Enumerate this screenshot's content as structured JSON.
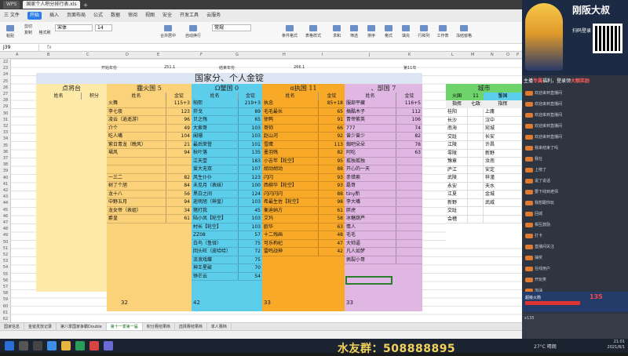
{
  "window": {
    "tabs": [
      "WPS",
      "国家个人积分排行表.xls"
    ],
    "plus": "+"
  },
  "menubar": {
    "items": [
      "三 文件",
      "开始",
      "插入",
      "页面布局",
      "公式",
      "数据",
      "审阅",
      "视图",
      "安全",
      "开发工具",
      "云服务"
    ],
    "active_index": 1
  },
  "ribbon": {
    "font_name": "宋体",
    "font_size": "14",
    "number_format": "常规",
    "buttons": [
      "粘贴",
      "剪切",
      "复制",
      "格式刷",
      "合并居中",
      "自动换行",
      "条件格式",
      "表格样式",
      "求和",
      "筛选",
      "排序",
      "格式",
      "填充",
      "行和列",
      "工作表",
      "冻结窗格"
    ]
  },
  "formula_bar": {
    "name_box": "J39",
    "fx": "fx"
  },
  "columns": [
    "A",
    "B",
    "C",
    "D",
    "E",
    "F",
    "G",
    "H",
    "I",
    "J",
    "K",
    "L",
    "M",
    "N",
    "O",
    "P"
  ],
  "rows": [
    "22",
    "23",
    "24",
    "25",
    "26",
    "27",
    "28",
    "29",
    "30",
    "31",
    "32",
    "33",
    "34",
    "35",
    "36",
    "37",
    "38",
    "39",
    "40",
    "41",
    "42",
    "43",
    "44",
    "45",
    "46",
    "47",
    "48",
    "49",
    "50",
    "51",
    "52",
    "53",
    "54",
    "55",
    "56",
    "57",
    "58",
    "59",
    "60",
    "61",
    "62"
  ],
  "header_row": {
    "start_label": "开始年份",
    "start_value": "251.1",
    "end_label": "结束年份",
    "end_value": "266.1",
    "round": "第11年"
  },
  "title": "国家分、个人金锭",
  "panels": {
    "dianjiangtai": {
      "title": "点将台",
      "col_name": "姓名",
      "col_score": "积分",
      "rows": []
    },
    "huoguo": {
      "title": "霾火国 5",
      "col_name": "姓名",
      "col_score": "金锭",
      "rows": [
        [
          "火舞",
          "115+3"
        ],
        [
          "李七夜",
          "123"
        ],
        [
          "凌云（逍遥游）",
          "96"
        ],
        [
          "介个",
          "49"
        ],
        [
          "吃人嘴",
          "104"
        ],
        [
          "紫日青龙（晚风）",
          "21"
        ],
        [
          "珺风",
          "94"
        ],
        [
          "",
          ""
        ],
        [
          "",
          ""
        ],
        [
          "一三二",
          "82"
        ],
        [
          "树了个旭",
          "84"
        ],
        [
          "龙十八",
          "56"
        ],
        [
          "中野五月",
          "94"
        ],
        [
          "龙女帝（表姐）",
          "34"
        ],
        [
          "爵皇",
          "61"
        ]
      ],
      "total": "32"
    },
    "xieguo": {
      "title": "Ω蟹国 0",
      "col_name": "姓名",
      "col_score": "金锭",
      "rows": [
        [
          "帕熙",
          "219+3"
        ],
        [
          "拌戈",
          "89"
        ],
        [
          "贝之殇",
          "65"
        ],
        [
          "大索哥",
          "103"
        ],
        [
          "阑珊",
          "103"
        ],
        [
          "最后荣誉",
          "101"
        ],
        [
          "秋叶落",
          "135"
        ],
        [
          "江天壹",
          "183"
        ],
        [
          "爱大无双",
          "107"
        ],
        [
          "风生仆仆",
          "123"
        ],
        [
          "未见月（表妹）",
          "100"
        ],
        [
          "黑白之间",
          "124"
        ],
        [
          "逝明旭（神皇）",
          "103"
        ],
        [
          "猪打我",
          "45"
        ],
        [
          "陆小凤【轮空】",
          "103"
        ],
        [
          "村长【轮空】",
          "103"
        ],
        [
          "ZZ08",
          "57"
        ],
        [
          "白鸟（鲁铎）",
          "75"
        ],
        [
          "回头旺（皮哈哈）",
          "72"
        ],
        [
          "流浪戏蝶",
          "75"
        ],
        [
          "神王星破",
          "70"
        ],
        [
          "铮芒云",
          "54"
        ]
      ],
      "total": "42"
    },
    "zhiguo": {
      "title": "α执国 11",
      "col_name": "姓名",
      "col_score": "金锭",
      "rows": [
        [
          "执念",
          "85+18"
        ],
        [
          "毛毛最长",
          "65"
        ],
        [
          "徐鸭",
          "91"
        ],
        [
          "哥帅",
          "66"
        ],
        [
          "赵山河",
          "92"
        ],
        [
          "雪鹰",
          "113"
        ],
        [
          "墨羽殇",
          "82"
        ],
        [
          "小吉年【轮空】",
          "95"
        ],
        [
          "胡动胡动",
          "88"
        ],
        [
          "闪闪",
          "93"
        ],
        [
          "西柳华【轮空】",
          "93"
        ],
        [
          "闪闪闪闪",
          "88"
        ],
        [
          "希最生佐【轮空】",
          "98"
        ],
        [
          "衡迪纳方",
          "61"
        ],
        [
          "艾玛",
          "58"
        ],
        [
          "欧华",
          "63"
        ],
        [
          "十二残画",
          "48"
        ],
        [
          "可乐枸杞",
          "47"
        ],
        [
          "雷鸣战神",
          "42"
        ]
      ],
      "total": "33"
    },
    "buguo": {
      "title": "、部国 7",
      "col_name": "姓名",
      "col_score": "金锭",
      "rows": [
        [
          "服部平藏",
          "116+5"
        ],
        [
          "搞酷木子",
          "112"
        ],
        [
          "青帝紫英",
          "106"
        ],
        [
          "777",
          "74"
        ],
        [
          "曾少曾少",
          "82"
        ],
        [
          "蜘吧朵朵",
          "78"
        ],
        [
          "阿吃",
          "63"
        ],
        [
          "孤独孤独",
          ""
        ],
        [
          "开心的一天",
          ""
        ],
        [
          "赤错索",
          ""
        ],
        [
          "磊哥",
          ""
        ],
        [
          "tiny新",
          ""
        ],
        [
          "李大嘴",
          ""
        ],
        [
          "胖虎",
          ""
        ],
        [
          "冰糖葫芦",
          ""
        ],
        [
          "情人",
          ""
        ],
        [
          "毛毛",
          ""
        ],
        [
          "大帅逼",
          ""
        ],
        [
          "凡人如梦",
          ""
        ],
        [
          "佩裂小哥",
          ""
        ]
      ],
      "total": "33"
    },
    "city": {
      "title": "城市",
      "sub1": "火国",
      "sub1_count": "11",
      "sub2": "蟹国",
      "col_a": "指挥",
      "col_b": "七政",
      "col_c": "指挥",
      "rows": [
        [
          "桂阳",
          "",
          "上庸"
        ],
        [
          "长沙",
          "",
          "汉中"
        ],
        [
          "南海",
          "",
          "宛城"
        ],
        [
          "交趾",
          "",
          "长安"
        ],
        [
          "江陵",
          "",
          "许昌"
        ],
        [
          "零陵",
          "",
          "新野"
        ],
        [
          "豫章",
          "",
          "汝南"
        ],
        [
          "庐江",
          "",
          "安定"
        ],
        [
          "武陵",
          "",
          "梓潼"
        ],
        [
          "永安",
          "",
          "天水"
        ],
        [
          "江夏",
          "",
          "金城"
        ],
        [
          "新野",
          "",
          "武威"
        ],
        [
          "交趾",
          "",
          ""
        ],
        [
          "会稽",
          "",
          ""
        ]
      ]
    }
  },
  "sheet_tabs": [
    "国家信息",
    "金锭发放记录",
    "第八季国家争霸Double",
    "第十一季第一届",
    "积分赛结果档",
    "选择赛结果档",
    "单人赛档"
  ],
  "active_sheet_index": 3,
  "status": "",
  "stream": {
    "logo": "刚阪大叔",
    "scan_text": "扫码登录",
    "promo_prefix": "主播",
    "promo_highlight": "专属",
    "promo_suffix": "福利，登录领",
    "promo_bonus": "大额奖励",
    "chat": [
      "欢迎来到直播间",
      "欢迎来到直播间",
      "欢迎来到直播间",
      "欢迎来到直播间",
      "欢迎来到直播间",
      "我来结束了吗",
      "我在",
      "上榜了",
      "说了说话",
      "要下线到老师",
      "我想跟你玩",
      "回城",
      "相互鼓励",
      "打卡",
      "直播间关注",
      "抽奖",
      "在线用户",
      "开玩笑",
      "加油",
      "来了"
    ],
    "gift_count": "135",
    "gift_label": "超级火箭",
    "viewers": "x135"
  },
  "taskbar": {
    "fans_group": "水友群：508888895",
    "clock": "21:01",
    "date": "2021/8/1",
    "temp": "27°C 晴朗"
  }
}
